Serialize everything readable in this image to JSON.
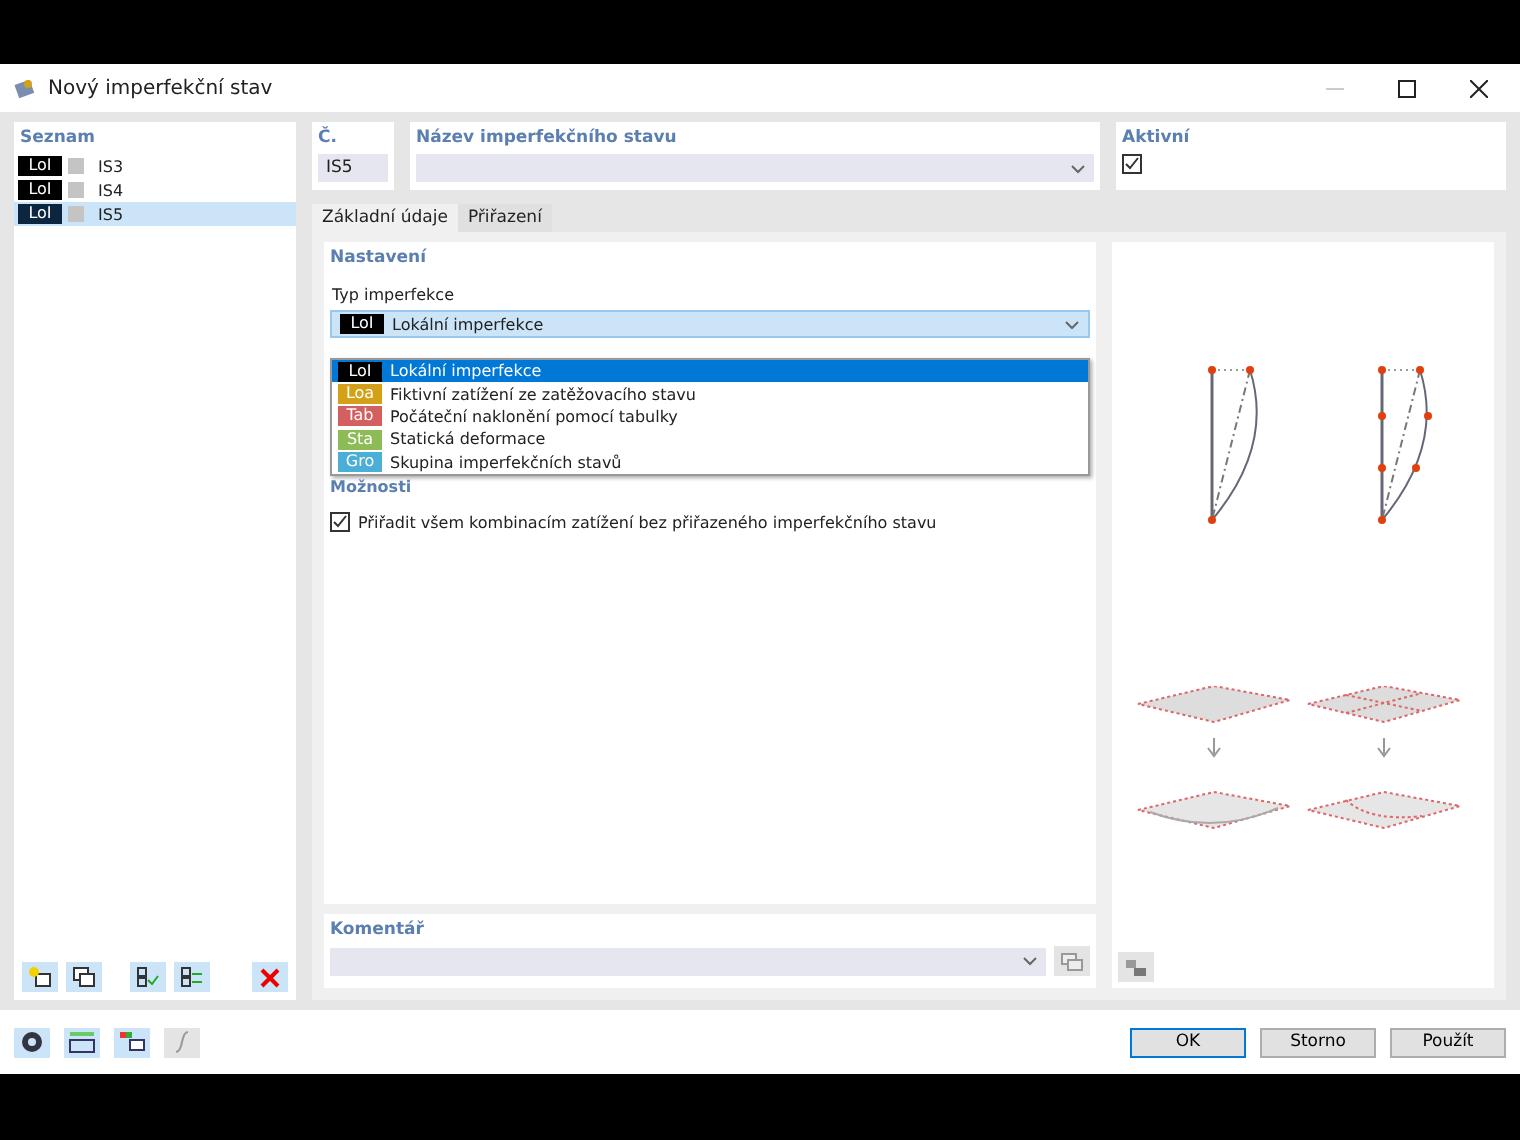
{
  "window": {
    "title": "Nový imperfekční stav"
  },
  "list": {
    "title": "Seznam",
    "items": [
      {
        "badge": "LoI",
        "name": "IS3",
        "selected": false,
        "color": "#c4c4c4"
      },
      {
        "badge": "LoI",
        "name": "IS4",
        "selected": false,
        "color": "#c4c4c4"
      },
      {
        "badge": "LoI",
        "name": "IS5",
        "selected": true,
        "color": "#c4c4c4"
      }
    ]
  },
  "number": {
    "label": "Č.",
    "value": "IS5"
  },
  "name": {
    "label": "Název imperfekčního stavu"
  },
  "active": {
    "label": "Aktivní",
    "checked": true
  },
  "tabs": [
    {
      "label": "Základní údaje",
      "selected": true
    },
    {
      "label": "Přiřazení",
      "selected": false
    }
  ],
  "settings": {
    "title": "Nastavení",
    "type_label": "Typ imperfekce",
    "value_badge": "LoI",
    "value": "Lokální imperfekce",
    "expanded": true,
    "options": [
      {
        "badge": "LoI",
        "color": "#000000",
        "label": "Lokální imperfekce",
        "selected": true
      },
      {
        "badge": "Loa",
        "color": "#d4a017",
        "label": "Fiktivní zatížení ze zatěžovacího stavu",
        "selected": false
      },
      {
        "badge": "Tab",
        "color": "#d45f5f",
        "label": "Počáteční naklonění pomocí tabulky",
        "selected": false
      },
      {
        "badge": "Sta",
        "color": "#8dbb55",
        "label": "Statická deformace",
        "selected": false
      },
      {
        "badge": "Gro",
        "color": "#4aaed6",
        "label": "Skupina imperfekčních stavů",
        "selected": false
      }
    ]
  },
  "options": {
    "title": "Možnosti",
    "checkbox": {
      "label": "Přiřadit všem kombinacím zatížení bez přiřazeného imperfekčního stavu",
      "checked": true
    }
  },
  "comment": {
    "label": "Komentář"
  },
  "buttons": [
    {
      "label": "OK",
      "selected": true
    },
    {
      "label": "Storno",
      "selected": false
    },
    {
      "label": "Použít",
      "selected": false
    }
  ]
}
